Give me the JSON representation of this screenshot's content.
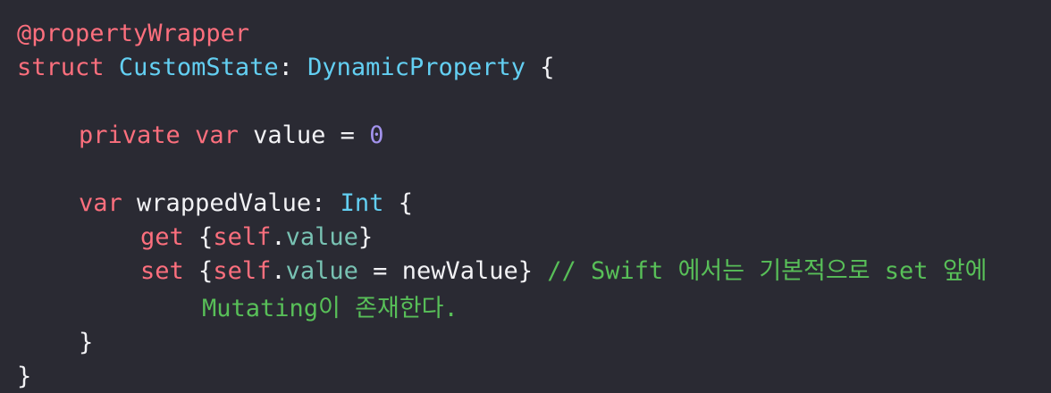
{
  "code": {
    "l1": "@propertyWrapper",
    "l2_kw": "struct",
    "l2_name": "CustomState",
    "l2_colon": ":",
    "l2_proto": "DynamicProperty",
    "l2_brace": "{",
    "l4_kw1": "private",
    "l4_kw2": "var",
    "l4_name": "value",
    "l4_eq": "=",
    "l4_num": "0",
    "l6_kw": "var",
    "l6_name": "wrappedValue",
    "l6_colon": ":",
    "l6_type": "Int",
    "l6_brace": "{",
    "l7_kw": "get",
    "l7_open": "{",
    "l7_self": "self",
    "l7_dot": ".",
    "l7_member": "value",
    "l7_close": "}",
    "l8_kw": "set",
    "l8_open": "{",
    "l8_self": "self",
    "l8_dot": ".",
    "l8_member": "value",
    "l8_eq": "=",
    "l8_rhs": "newValue",
    "l8_close": "}",
    "l8_comment": "// Swift 에서는 기본적으로 set 앞에",
    "l9_comment": "Mutating이 존재한다.",
    "l10_brace": "}",
    "l11_brace": "}"
  },
  "colors": {
    "background": "#2a2a33",
    "keyword": "#fc6f7d",
    "type": "#63cff2",
    "plain": "#f2f2f5",
    "number": "#a393ed",
    "member": "#78c2b3",
    "comment": "#58bf58"
  }
}
